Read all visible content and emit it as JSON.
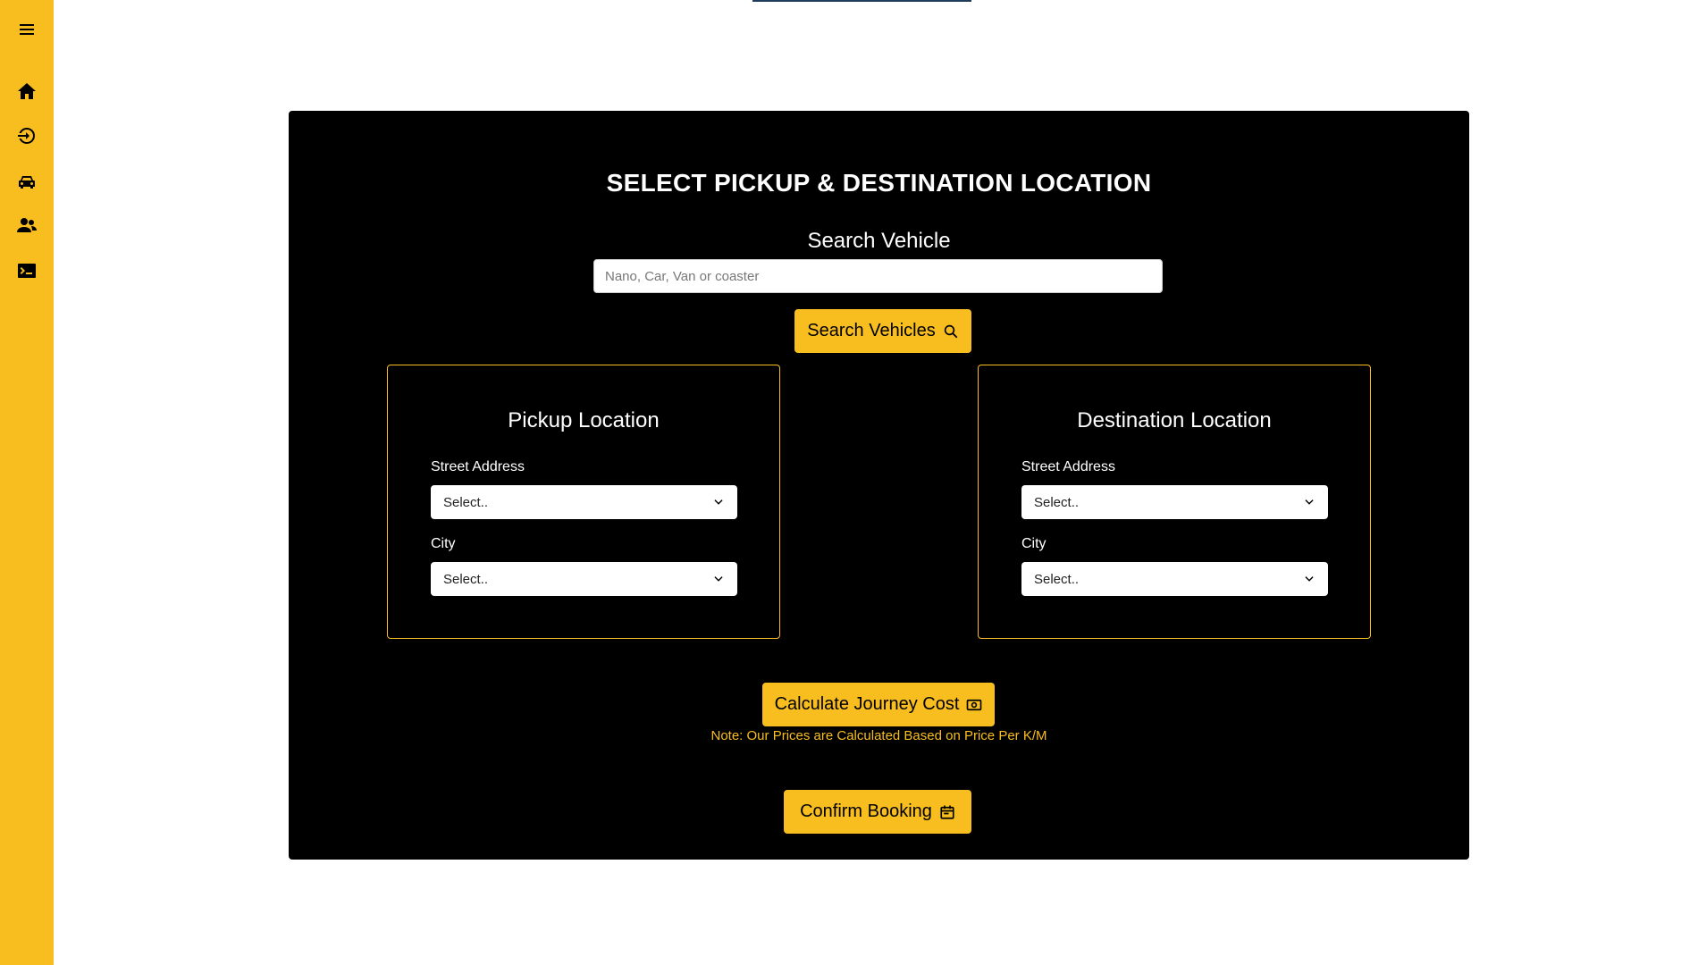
{
  "sidebar": {
    "items": [
      {
        "icon": "menu-icon"
      },
      {
        "icon": "home-icon"
      },
      {
        "icon": "logout-icon"
      },
      {
        "icon": "car-icon"
      },
      {
        "icon": "users-icon"
      },
      {
        "icon": "terminal-icon"
      }
    ]
  },
  "panel": {
    "title": "SELECT PICKUP & DESTINATION LOCATION",
    "search_label": "Search Vehicle",
    "search_placeholder": "Nano, Car, Van or coaster",
    "search_button": "Search Vehicles",
    "pickup": {
      "title": "Pickup Location",
      "street_label": "Street Address",
      "street_value": "Select..",
      "city_label": "City",
      "city_value": "Select.."
    },
    "destination": {
      "title": "Destination Location",
      "street_label": "Street Address",
      "street_value": "Select..",
      "city_label": "City",
      "city_value": "Select.."
    },
    "calculate_button": "Calculate Journey Cost",
    "note": "Note: Our Prices are Calculated Based on Price Per K/M",
    "confirm_button": "Confirm Booking"
  },
  "colors": {
    "accent": "#f8bd1f",
    "panel_bg": "#000000",
    "page_bg": "#ffffff"
  }
}
